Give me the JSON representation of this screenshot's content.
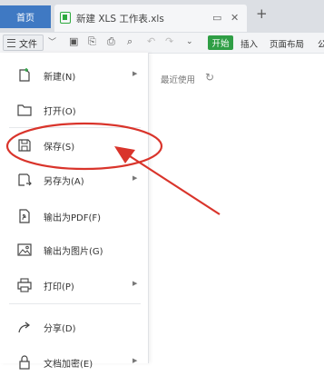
{
  "tabs": {
    "home_label": "首页",
    "doc_title": "新建 XLS 工作表.xls",
    "new_tab_symbol": "+"
  },
  "toolbar": {
    "file_label": "文件",
    "ribbon_tabs": [
      "开始",
      "插入",
      "页面布局",
      "公"
    ]
  },
  "file_menu": {
    "items": [
      {
        "label": "新建(N)",
        "icon": "new-doc-icon",
        "submenu": true
      },
      {
        "label": "打开(O)",
        "icon": "folder-icon",
        "submenu": false
      },
      {
        "label": "保存(S)",
        "icon": "save-icon",
        "submenu": false
      },
      {
        "label": "另存为(A)",
        "icon": "save-as-icon",
        "submenu": true
      },
      {
        "label": "输出为PDF(F)",
        "icon": "pdf-icon",
        "submenu": false
      },
      {
        "label": "输出为图片(G)",
        "icon": "image-icon",
        "submenu": false
      },
      {
        "label": "打印(P)",
        "icon": "printer-icon",
        "submenu": true
      },
      {
        "label": "分享(D)",
        "icon": "share-icon",
        "submenu": false
      },
      {
        "label": "文档加密(E)",
        "icon": "lock-icon",
        "submenu": true
      }
    ]
  },
  "recent": {
    "title": "最近使用"
  },
  "annotation": {
    "color": "#d9342b"
  }
}
